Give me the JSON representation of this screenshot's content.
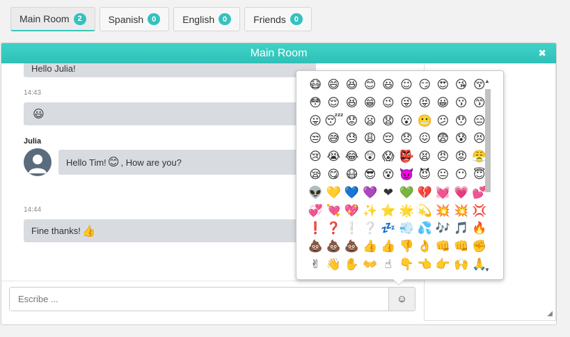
{
  "tabs": [
    {
      "label": "Main Room",
      "count": "2"
    },
    {
      "label": "Spanish",
      "count": "0"
    },
    {
      "label": "English",
      "count": "0"
    },
    {
      "label": "Friends",
      "count": "0"
    }
  ],
  "chat": {
    "title": "Main Room",
    "close": "✖",
    "messages": {
      "m1_text": "Hello Julia!",
      "m2_time": "14:43",
      "m2_emoji": "😃",
      "julia_name": "Julia",
      "m3_text_a": "Hello Tim!",
      "m3_emoji": "😊",
      "m3_text_b": ", How are you?",
      "m4_time": "14:44",
      "m4_text": "Fine thanks!",
      "m4_emoji": "👍"
    },
    "input_placeholder": "Escribe ...",
    "emoji_button": "☺"
  },
  "emoji_picker": {
    "emojis": [
      "😷",
      "😄",
      "😆",
      "😊",
      "😃",
      "☺",
      "😏",
      "😍",
      "😘",
      "😚",
      "😳",
      "😌",
      "😆",
      "😁",
      "😉",
      "😜",
      "😝",
      "😀",
      "😗",
      "😙",
      "😛",
      "😴",
      "😟",
      "😦",
      "😧",
      "😮",
      "😬",
      "😕",
      "😯",
      "😑",
      "😒",
      "😅",
      "😓",
      "😩",
      "😔",
      "😞",
      "😖",
      "😨",
      "😰",
      "😣",
      "😢",
      "😭",
      "😂",
      "😲",
      "😱",
      "👺",
      "😫",
      "😠",
      "😡",
      "😤",
      "😪",
      "😋",
      "😷",
      "😎",
      "😵",
      "👿",
      "😈",
      "😐",
      "😶",
      "😇",
      "👽",
      "💛",
      "💙",
      "💜",
      "❤",
      "💚",
      "💔",
      "💓",
      "💗",
      "💕",
      "💞",
      "💘",
      "💖",
      "✨",
      "⭐",
      "🌟",
      "💫",
      "💥",
      "💥",
      "💢",
      "❗",
      "❓",
      "❕",
      "❔",
      "💤",
      "💨",
      "💦",
      "🎶",
      "🎵",
      "🔥",
      "💩",
      "💩",
      "💩",
      "👍",
      "👍",
      "👎",
      "👌",
      "👊",
      "👊",
      "✊",
      "✌",
      "👋",
      "✋",
      "👐",
      "☝",
      "👇",
      "👈",
      "👉",
      "🙌",
      "🙏"
    ],
    "scroll_up": "▲",
    "scroll_down": "▼"
  }
}
